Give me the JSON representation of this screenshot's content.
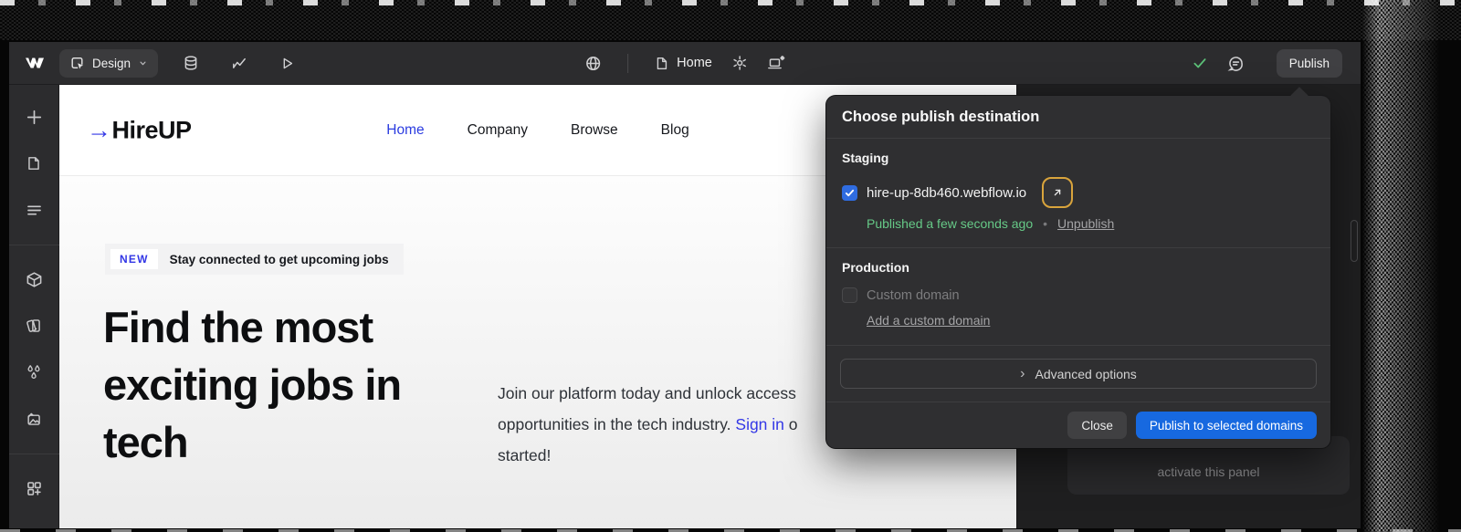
{
  "colors": {
    "accent_blue": "#3337e6",
    "primary_blue": "#1769e0",
    "checkbox_blue": "#2f6ce0",
    "status_green": "#66c987",
    "focus_ring_amber": "#d9a43c"
  },
  "icons": {
    "logo_arrow": "→",
    "open_arrow": "↗",
    "chevron_right": "›",
    "bullet": "•"
  },
  "app": {
    "topbar": {
      "mode_label": "Design",
      "page_name": "Home",
      "publish_label": "Publish"
    },
    "sidebar_items": [
      "add-element",
      "pages",
      "navigator",
      "components",
      "style-manager",
      "variables",
      "assets",
      "apps"
    ],
    "right_panel": {
      "hint_visible_text": "activate this panel"
    }
  },
  "site": {
    "logo_text": "HireUP",
    "nav": [
      {
        "label": "Home",
        "active": true
      },
      {
        "label": "Company",
        "active": false
      },
      {
        "label": "Browse",
        "active": false
      },
      {
        "label": "Blog",
        "active": false
      }
    ],
    "badge_tag": "NEW",
    "badge_text": "Stay connected to get upcoming jobs",
    "heading": "Find the most\nexciting jobs in\ntech",
    "paragraph": {
      "line1": "Join our platform today and unlock access",
      "line2_pre": "opportunities in the tech industry. ",
      "line2_link": "Sign in",
      "line2_post": " o",
      "line3": "started!"
    }
  },
  "publish_popup": {
    "title": "Choose publish destination",
    "staging_label": "Staging",
    "staging_domain": "hire-up-8db460.webflow.io",
    "staging_status": "Published a few seconds ago",
    "unpublish_label": "Unpublish",
    "production_label": "Production",
    "custom_domain_label": "Custom domain",
    "add_custom_domain_label": "Add a custom domain",
    "advanced_label": "Advanced options",
    "close_label": "Close",
    "publish_button_label": "Publish to selected domains"
  }
}
